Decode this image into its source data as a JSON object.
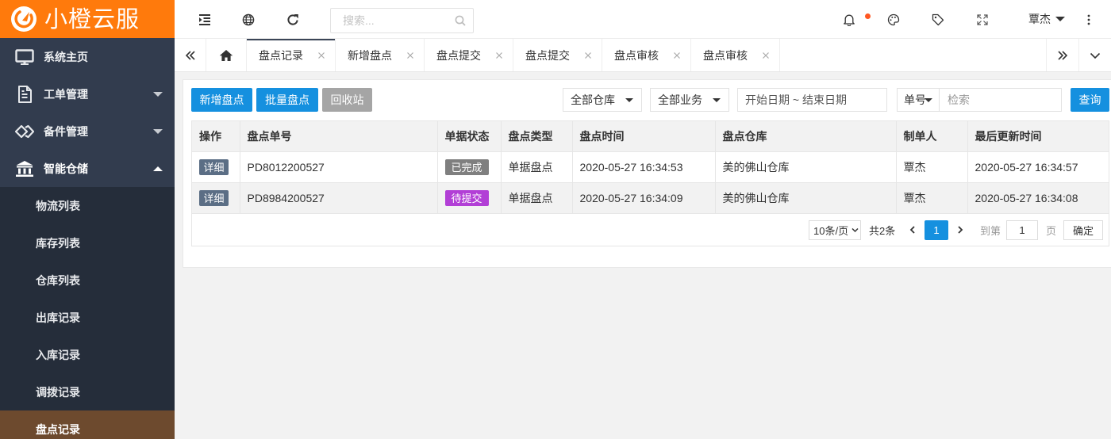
{
  "app": {
    "logo_text": "小橙云服"
  },
  "colors": {
    "brand": "#ff7a0c",
    "sidebar_bg": "#323c4e",
    "submenu_bg": "#252d3a",
    "menu_active": "#6d4a2e",
    "primary": "#1590df",
    "muted_button": "#a5a5a5",
    "detail_button": "#5b6e85",
    "notification_dot": "#ff5722"
  },
  "sidebar": {
    "items": [
      {
        "label": "系统主页",
        "icon": "monitor-icon",
        "expanded": false
      },
      {
        "label": "工单管理",
        "icon": "document-icon",
        "expanded": false
      },
      {
        "label": "备件管理",
        "icon": "chain-icon",
        "expanded": false
      },
      {
        "label": "智能仓储",
        "icon": "bank-icon",
        "expanded": true
      }
    ],
    "submenu": [
      {
        "label": "物流列表",
        "active": false
      },
      {
        "label": "库存列表",
        "active": false
      },
      {
        "label": "仓库列表",
        "active": false
      },
      {
        "label": "出库记录",
        "active": false
      },
      {
        "label": "入库记录",
        "active": false
      },
      {
        "label": "调拨记录",
        "active": false
      },
      {
        "label": "盘点记录",
        "active": true
      }
    ]
  },
  "header": {
    "search_placeholder": "搜索...",
    "user_name": "覃杰",
    "has_notification": true
  },
  "tabs": [
    {
      "label": "盘点记录",
      "active": true
    },
    {
      "label": "新增盘点",
      "active": false
    },
    {
      "label": "盘点提交",
      "active": false
    },
    {
      "label": "盘点提交",
      "active": false
    },
    {
      "label": "盘点审核",
      "active": false
    },
    {
      "label": "盘点审核",
      "active": false
    }
  ],
  "toolbar": {
    "add_label": "新增盘点",
    "batch_label": "批量盘点",
    "recycle_label": "回收站",
    "warehouse_select": "全部仓库",
    "business_select": "全部业务",
    "date_range_placeholder": "开始日期 ~ 结束日期",
    "field_select": "单号",
    "keyword_placeholder": "检索",
    "query_label": "查询"
  },
  "table": {
    "columns": [
      "操作",
      "盘点单号",
      "单据状态",
      "盘点类型",
      "盘点时间",
      "盘点仓库",
      "制单人",
      "最后更新时间"
    ],
    "rows": [
      {
        "action": "详细",
        "order_no": "PD8012200527",
        "status": "已完成",
        "status_color": "#7f7f7f",
        "type": "单据盘点",
        "time": "2020-05-27 16:34:53",
        "warehouse": "美的佛山仓库",
        "creator": "覃杰",
        "updated": "2020-05-27 16:34:57"
      },
      {
        "action": "详细",
        "order_no": "PD8984200527",
        "status": "待提交",
        "status_color": "#b23fd6",
        "type": "单据盘点",
        "time": "2020-05-27 16:34:09",
        "warehouse": "美的佛山仓库",
        "creator": "覃杰",
        "updated": "2020-05-27 16:34:08"
      }
    ]
  },
  "pagination": {
    "page_size": "10条/页",
    "total": "共2条",
    "current": "1",
    "goto_prefix": "到第",
    "goto_value": "1",
    "goto_suffix": "页",
    "confirm": "确定"
  }
}
